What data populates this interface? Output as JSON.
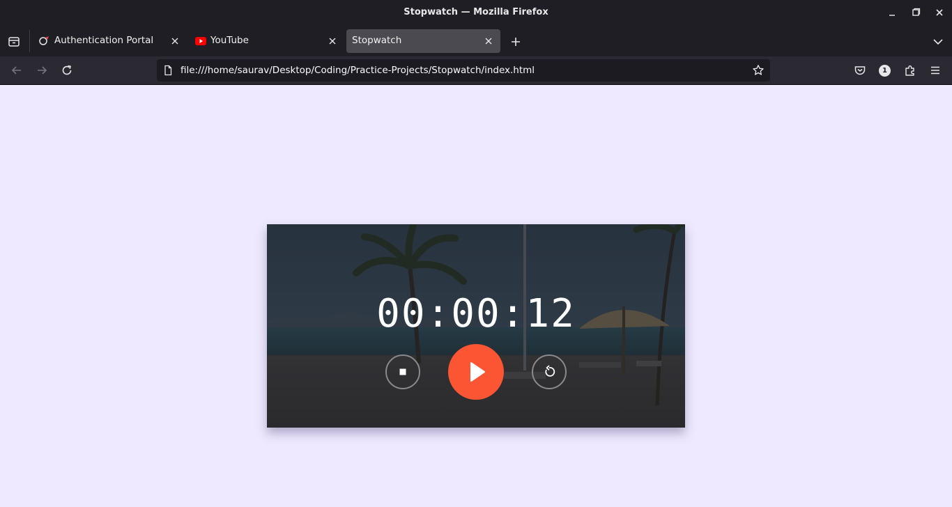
{
  "window": {
    "title": "Stopwatch — Mozilla Firefox"
  },
  "tabs": [
    {
      "label": "Authentication Portal",
      "active": false
    },
    {
      "label": "YouTube",
      "active": false
    },
    {
      "label": "Stopwatch",
      "active": true
    }
  ],
  "navbar": {
    "url": "file:///home/saurav/Desktop/Coding/Practice-Projects/Stopwatch/index.html",
    "account_badge": "1"
  },
  "stopwatch": {
    "time": "00:00:12",
    "play_color": "#fb5533"
  },
  "colors": {
    "page_background": "#eee9fe",
    "chrome_dark": "#1f1e24",
    "toolbar": "#2b2a33"
  }
}
